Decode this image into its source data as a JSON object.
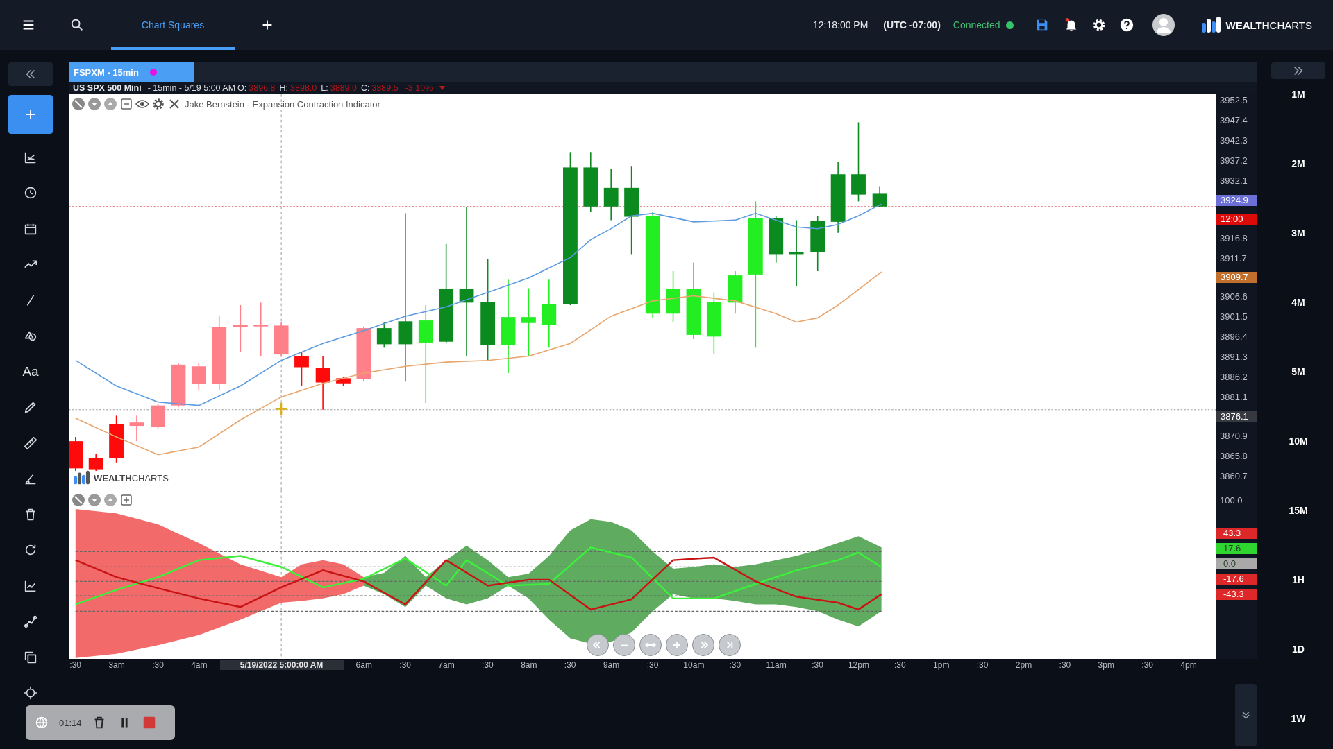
{
  "top_bar": {
    "tabs": [
      {
        "label": "Chart Squares",
        "selected": true
      }
    ],
    "clock": "12:18:00 PM",
    "timezone": "(UTC -07:00)",
    "connection": {
      "label": "Connected",
      "connected": true
    },
    "notifications": {
      "unread": true
    },
    "brand": "**WEALTH**CHARTS"
  },
  "sidebar": {
    "text_tool": "Aa"
  },
  "chart": {
    "tab": {
      "label": "FSPXM - 15min"
    },
    "symbol": "US SPX 500 Mini",
    "details": "- 15min - 5/19 5:00 AM",
    "ohlc": [
      {
        "label": "O:",
        "value": "3896.8"
      },
      {
        "label": "H:",
        "value": "3898.0"
      },
      {
        "label": "L:",
        "value": "3889.0"
      },
      {
        "label": "C:",
        "value": "3889.5"
      }
    ],
    "change": "-3.10%",
    "indicator_name": "Jake Bernstein - Expansion Contraction Indicator",
    "watermark": "**WEALTH**CHARTS",
    "price_axis": [
      {
        "kind": "tick",
        "label": "3952.5"
      },
      {
        "kind": "tick",
        "label": "3947.4"
      },
      {
        "kind": "tick",
        "label": "3942.3"
      },
      {
        "kind": "tick",
        "label": "3937.2"
      },
      {
        "kind": "tick",
        "label": "3932.1"
      },
      {
        "kind": "tag",
        "label": "3924.9",
        "color": "#6b6fd6"
      },
      {
        "kind": "tag",
        "label": "12:00",
        "color": "#dd0a0a"
      },
      {
        "kind": "tick",
        "label": "3916.8"
      },
      {
        "kind": "tick",
        "label": "3911.7"
      },
      {
        "kind": "tag",
        "label": "3909.7",
        "color": "#c0702c"
      },
      {
        "kind": "tick",
        "label": "3906.6"
      },
      {
        "kind": "tick",
        "label": "3901.5"
      },
      {
        "kind": "tick",
        "label": "3896.4"
      },
      {
        "kind": "tick",
        "label": "3891.3"
      },
      {
        "kind": "tick",
        "label": "3886.2"
      },
      {
        "kind": "tick",
        "label": "3881.1"
      },
      {
        "kind": "tag",
        "label": "3876.1",
        "color": "#363a40"
      },
      {
        "kind": "tick",
        "label": "3870.9"
      },
      {
        "kind": "tick",
        "label": "3865.8"
      },
      {
        "kind": "tick",
        "label": "3860.7"
      }
    ],
    "indicator_axis": [
      {
        "kind": "tick",
        "label": "100.0"
      },
      {
        "kind": "tag",
        "label": "43.3",
        "color": "#dc2828"
      },
      {
        "kind": "tag",
        "label": "17.6",
        "color": "#2fd62f"
      },
      {
        "kind": "tag",
        "label": "0.0",
        "color": "#a9a9a9"
      },
      {
        "kind": "tag",
        "label": "-17.6",
        "color": "#dc2828"
      },
      {
        "kind": "tag",
        "label": "-43.3",
        "color": "#dc2828"
      }
    ],
    "time_axis": [
      {
        "kind": "tick",
        "label": ":30"
      },
      {
        "kind": "tick",
        "label": "3am"
      },
      {
        "kind": "tick",
        "label": ":30"
      },
      {
        "kind": "tick",
        "label": "4am"
      },
      {
        "kind": "crosshair",
        "label": "5/19/2022 5:00:00 AM"
      },
      {
        "kind": "tick",
        "label": "6am"
      },
      {
        "kind": "tick",
        "label": ":30"
      },
      {
        "kind": "tick",
        "label": "7am"
      },
      {
        "kind": "tick",
        "label": ":30"
      },
      {
        "kind": "tick",
        "label": "8am"
      },
      {
        "kind": "tick",
        "label": ":30"
      },
      {
        "kind": "tick",
        "label": "9am"
      },
      {
        "kind": "tick",
        "label": ":30"
      },
      {
        "kind": "tick",
        "label": "10am"
      },
      {
        "kind": "tick",
        "label": ":30"
      },
      {
        "kind": "tick",
        "label": "11am"
      },
      {
        "kind": "tick",
        "label": ":30"
      },
      {
        "kind": "tick",
        "label": "12pm"
      },
      {
        "kind": "tick",
        "label": ":30"
      },
      {
        "kind": "tick",
        "label": "1pm"
      },
      {
        "kind": "tick",
        "label": ":30"
      },
      {
        "kind": "tick",
        "label": "2pm"
      },
      {
        "kind": "tick",
        "label": ":30"
      },
      {
        "kind": "tick",
        "label": "3pm"
      },
      {
        "kind": "tick",
        "label": ":30"
      },
      {
        "kind": "tick",
        "label": "4pm"
      }
    ]
  },
  "timeframes": [
    "1M",
    "2M",
    "3M",
    "4M",
    "5M",
    "10M",
    "15M",
    "1H",
    "1D",
    "1W"
  ],
  "recorder": {
    "elapsed": "01:14"
  }
}
